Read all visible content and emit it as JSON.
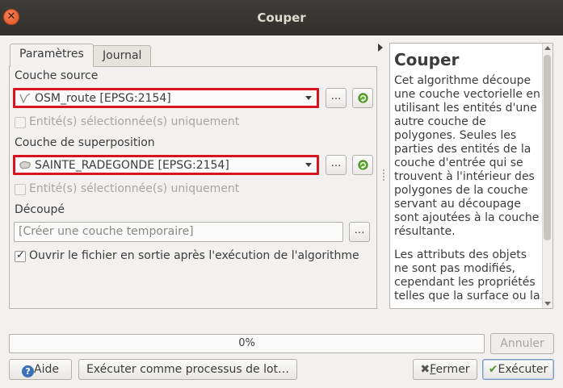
{
  "window": {
    "title": "Couper"
  },
  "tabs": [
    {
      "label": "Paramètres"
    },
    {
      "label": "Journal"
    }
  ],
  "params": {
    "source_label": "Couche source",
    "source_value": "OSM_route [EPSG:2154]",
    "source_selected_only": "Entité(s) sélectionnée(s) uniquement",
    "overlay_label": "Couche de superposition",
    "overlay_value": "SAINTE_RADEGONDE [EPSG:2154]",
    "overlay_selected_only": "Entité(s) sélectionnée(s) uniquement",
    "output_label": "Découpé",
    "output_placeholder": "[Créer une couche temporaire]",
    "open_output_label": "Ouvrir le fichier en sortie après l'exécution de l'algorithme",
    "browse_label": "…"
  },
  "help": {
    "title": "Couper",
    "paragraphs": [
      "Cet algorithme découpe une couche vectorielle en utilisant les entités d'une autre couche de polygones. Seules les parties des entités de la couche d'entrée qui se trouvent à l'intérieur des polygones de la couche servant au découpage sont ajoutées à la couche résultante.",
      "Les attributs des objets ne sont pas modifiés, cependant les propriétés telles que la surface ou la"
    ]
  },
  "progress": {
    "text": "0%",
    "value": 0
  },
  "buttons": {
    "cancel": "Annuler",
    "help": "Aide",
    "batch": "Exécuter comme processus de lot…",
    "close_prefix": "",
    "close_u": "F",
    "close_rest": "ermer",
    "run": "Exécuter"
  },
  "icons": {
    "close": "close-icon",
    "line_layer": "line-layer-icon",
    "polygon_layer": "polygon-layer-icon",
    "iterate": "iterate-icon",
    "help": "help-icon",
    "check": "checkmark-icon",
    "close_button": "close-x-icon"
  },
  "colors": {
    "highlight": "#d8141e",
    "titlebar": "#302f2b"
  }
}
